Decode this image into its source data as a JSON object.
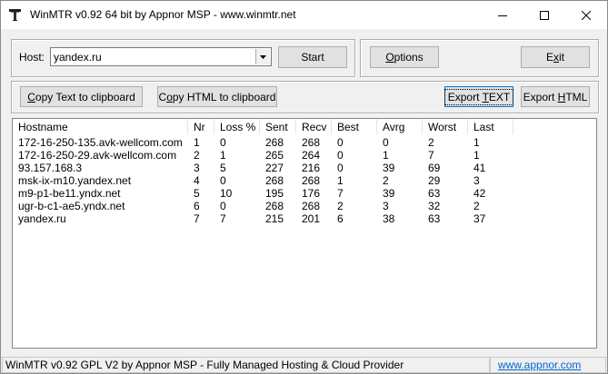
{
  "window": {
    "title": "WinMTR v0.92 64 bit by Appnor MSP - www.winmtr.net"
  },
  "host": {
    "label": "Host:",
    "value": "yandex.ru"
  },
  "buttons": {
    "start": "Start",
    "options": {
      "pre": "",
      "accel": "O",
      "post": "ptions"
    },
    "exit": {
      "pre": "E",
      "accel": "x",
      "post": "it"
    },
    "copy_text": {
      "pre": "",
      "accel": "C",
      "post": "opy Text to clipboard"
    },
    "copy_html": {
      "pre": "C",
      "accel": "o",
      "post": "py HTML to clipboard"
    },
    "export_text": {
      "pre": "Export ",
      "accel": "T",
      "post": "EXT"
    },
    "export_html": {
      "pre": "Export ",
      "accel": "H",
      "post": "TML"
    }
  },
  "table": {
    "columns": [
      "Hostname",
      "Nr",
      "Loss %",
      "Sent",
      "Recv",
      "Best",
      "Avrg",
      "Worst",
      "Last"
    ],
    "rows": [
      [
        "172-16-250-135.avk-wellcom.com",
        "1",
        "0",
        "268",
        "268",
        "0",
        "0",
        "2",
        "1"
      ],
      [
        "172-16-250-29.avk-wellcom.com",
        "2",
        "1",
        "265",
        "264",
        "0",
        "1",
        "7",
        "1"
      ],
      [
        "93.157.168.3",
        "3",
        "5",
        "227",
        "216",
        "0",
        "39",
        "69",
        "41"
      ],
      [
        "msk-ix-m10.yandex.net",
        "4",
        "0",
        "268",
        "268",
        "1",
        "2",
        "29",
        "3"
      ],
      [
        "m9-p1-be11.yndx.net",
        "5",
        "10",
        "195",
        "176",
        "7",
        "39",
        "63",
        "42"
      ],
      [
        "ugr-b-c1-ae5.yndx.net",
        "6",
        "0",
        "268",
        "268",
        "2",
        "3",
        "32",
        "2"
      ],
      [
        "yandex.ru",
        "7",
        "7",
        "215",
        "201",
        "6",
        "38",
        "63",
        "37"
      ]
    ]
  },
  "status": {
    "text": "WinMTR v0.92 GPL V2 by Appnor MSP - Fully Managed Hosting & Cloud Provider",
    "link": "www.appnor.com",
    "link_color": "#0066cc"
  },
  "icons": [
    "app-icon",
    "minimize-icon",
    "maximize-icon",
    "close-icon",
    "chevron-down-icon"
  ]
}
